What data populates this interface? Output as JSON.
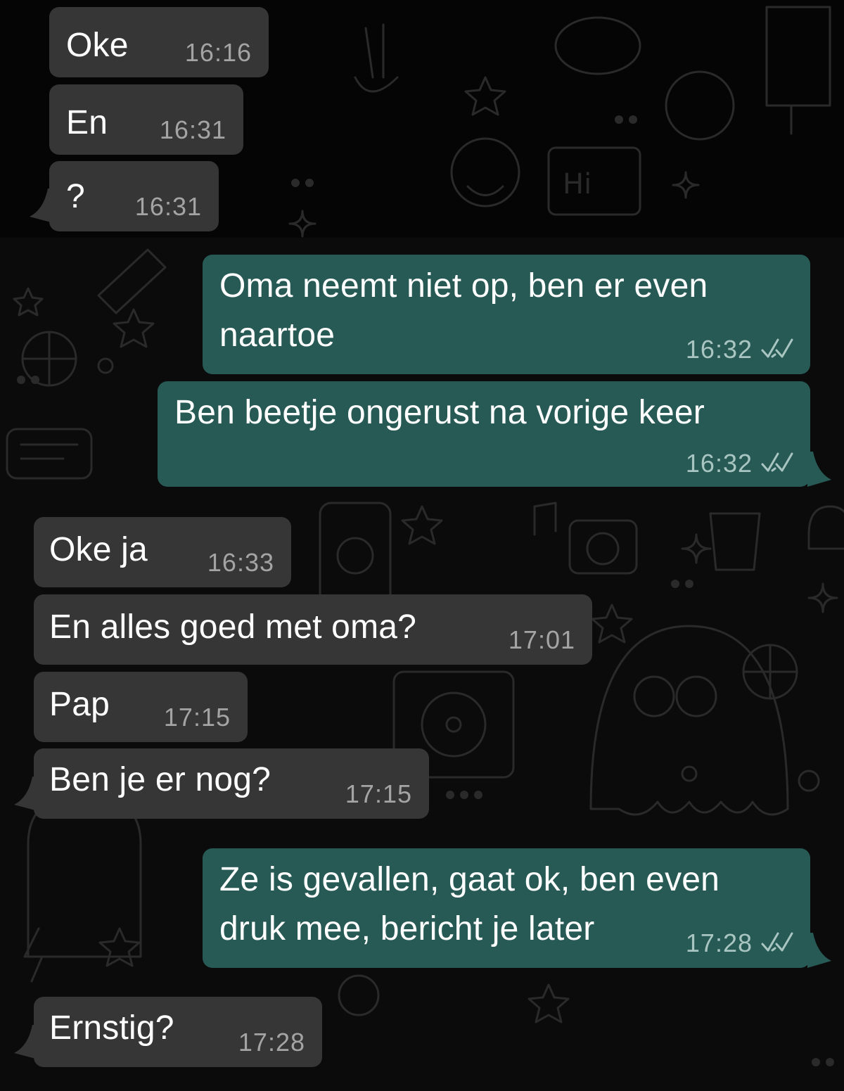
{
  "colors": {
    "incoming_bubble": "#363636",
    "outgoing_bubble": "#285a55",
    "background": "#0b0b0b",
    "timestamp": "#a4a4a4",
    "read_ticks": "#a8c5c1"
  },
  "wallpaper": {
    "doodle_labels": [
      "Hi"
    ]
  },
  "messages": [
    {
      "direction": "incoming",
      "text": "Oke",
      "time": "16:16"
    },
    {
      "direction": "incoming",
      "text": "En",
      "time": "16:31"
    },
    {
      "direction": "incoming",
      "text": "?",
      "time": "16:31"
    },
    {
      "direction": "outgoing",
      "lines": [
        "Oma neemt niet op, ben er even",
        "naartoe"
      ],
      "time": "16:32",
      "status_icon": "double-check-icon"
    },
    {
      "direction": "outgoing",
      "text": "Ben beetje ongerust na vorige keer",
      "time": "16:32",
      "status_icon": "double-check-icon"
    },
    {
      "direction": "incoming",
      "text": "Oke ja",
      "time": "16:33"
    },
    {
      "direction": "incoming",
      "text": "En alles goed met oma?",
      "time": "17:01"
    },
    {
      "direction": "incoming",
      "text": "Pap",
      "time": "17:15"
    },
    {
      "direction": "incoming",
      "text": "Ben je er nog?",
      "time": "17:15"
    },
    {
      "direction": "outgoing",
      "lines": [
        "Ze is gevallen, gaat ok, ben even",
        "druk mee, bericht je later"
      ],
      "time": "17:28",
      "status_icon": "double-check-icon"
    },
    {
      "direction": "incoming",
      "text": "Ernstig?",
      "time": "17:28"
    }
  ]
}
